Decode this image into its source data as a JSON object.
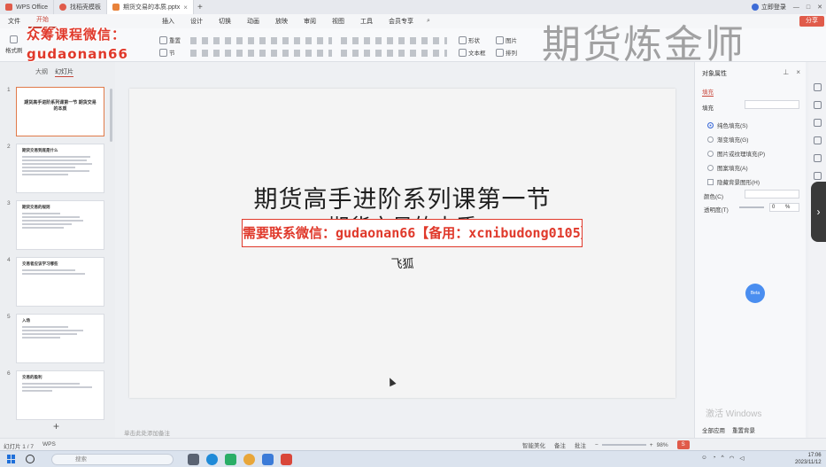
{
  "tabs": [
    {
      "label": "WPS Office",
      "color": "#e05b4a",
      "active": false
    },
    {
      "label": "找稻壳模板",
      "color": "#e05b4a",
      "active": false
    },
    {
      "label": "期货交易的本质.pptx",
      "color": "#e8823a",
      "active": true
    }
  ],
  "window": {
    "login_label": "立即登录"
  },
  "menu": {
    "items": [
      "文件",
      "开始",
      "插入",
      "设计",
      "切换",
      "动画",
      "放映",
      "审阅",
      "视图",
      "工具",
      "会员专享"
    ],
    "active": "开始"
  },
  "share_label": "分享",
  "ribbon": {
    "format_painter": "格式刷",
    "reset": "重置",
    "section": "节",
    "shape": "形状",
    "image": "图片",
    "textbox": "文本框",
    "arrange": "排列",
    "ab_sample": "Aa"
  },
  "left_panel": {
    "tabs": [
      "大纲",
      "幻灯片"
    ],
    "slides": [
      {
        "num": "1",
        "title": "期货高手进阶系列课第一节 期货交易的本质",
        "lines": 0
      },
      {
        "num": "2",
        "title": "期货交易到底是什么",
        "lines": 6
      },
      {
        "num": "3",
        "title": "期货交易的规则",
        "lines": 5
      },
      {
        "num": "4",
        "title": "交易者应该学习哪些",
        "lines": 2
      },
      {
        "num": "5",
        "title": "入场",
        "lines": 4
      },
      {
        "num": "6",
        "title": "交易的盈利",
        "lines": 3
      }
    ]
  },
  "slide": {
    "title": "期货高手进阶系列课第一节",
    "subtitle": "期货交易的本质",
    "author": "飞狐"
  },
  "notes_placeholder": "单击此处添加备注",
  "promo": {
    "line1": "众筹课程微信：",
    "line2": "gudaonan66"
  },
  "brand_watermark": "期货炼金师",
  "wechat_banner": "需要联系微信：gudaonan66【备用：xcnibudong0105】",
  "right_pane": {
    "title": "对象属性",
    "sub_tab": "填充",
    "section": "填充",
    "options": [
      {
        "label": "纯色填充(S)",
        "selected": true
      },
      {
        "label": "渐变填充(G)",
        "selected": false
      },
      {
        "label": "图片或纹理填充(P)",
        "selected": false
      },
      {
        "label": "图案填充(A)",
        "selected": false
      }
    ],
    "hide_bg_label": "隐藏背景图形(H)",
    "color_label": "颜色(C)",
    "transparency_label": "透明度(T)",
    "transparency_value": "0",
    "transparency_unit": "%",
    "activate_text": "激活 Windows",
    "apply_all": "全部应用",
    "reset_bg": "重置背景"
  },
  "blue_bubble": "Beta",
  "status": {
    "slide_counter": "幻灯片 1 / 7",
    "theme": "WPS",
    "smart_beautify": "智能美化",
    "notes": "备注",
    "comment": "批注",
    "zoom": "98%",
    "ime": "S"
  },
  "taskbar": {
    "search_placeholder": "搜索",
    "time": "17:06",
    "date": "2023/11/12"
  }
}
